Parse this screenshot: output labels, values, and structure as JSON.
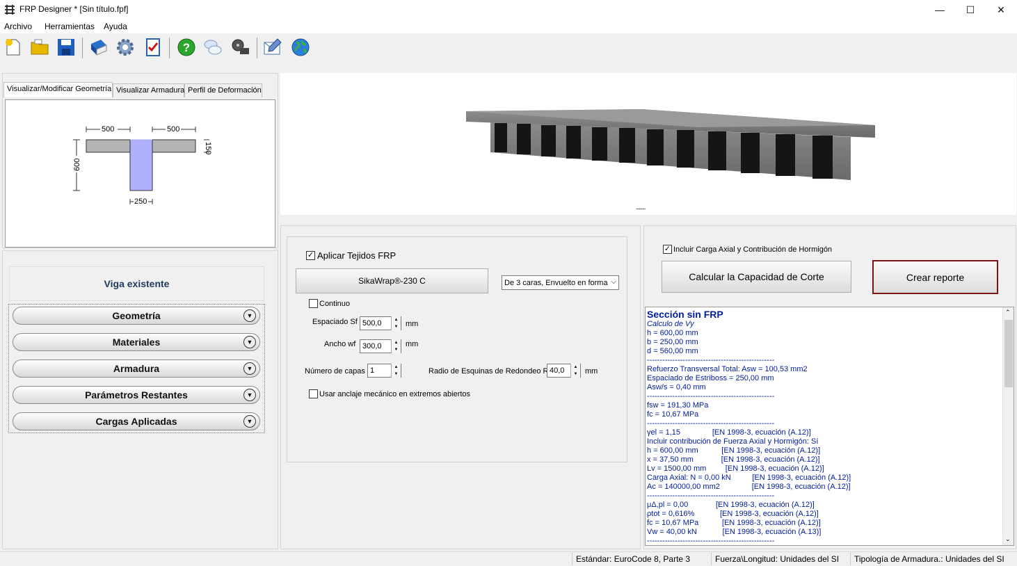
{
  "window": {
    "title": "FRP Designer * [Sin título.fpf]",
    "minimize": "—",
    "maximize": "☐",
    "close": "✕"
  },
  "menu": [
    "Archivo",
    "Herramientas",
    "Ayuda"
  ],
  "toolbar": {
    "icons": [
      "new-file-icon",
      "open-folder-icon",
      "save-icon",
      "book-icon",
      "gear-icon",
      "checklist-icon",
      "help-icon",
      "chat-icon",
      "film-icon",
      "mail-icon",
      "globe-icon"
    ]
  },
  "left": {
    "tabs": [
      "Visualizar/Modificar Geometría",
      "Visualizar Armadura",
      "Perfil de Deformación"
    ],
    "geometry": {
      "flange_left": "500",
      "flange_right": "500",
      "flange_thickness": "150",
      "height": "600",
      "web_width": "250"
    },
    "section_title": "Viga existente",
    "accordion": [
      "Geometría",
      "Materiales",
      "Armadura",
      "Parámetros Restantes",
      "Cargas Aplicadas"
    ]
  },
  "viewer": {
    "splitter": "........."
  },
  "frp": {
    "apply_label": "Aplicar Tejidos FRP",
    "apply_checked": "✓",
    "product_button": "SikaWrap®-230 C",
    "config_select": "De 3 caras, Envuelto en forma",
    "continuous_label": "Continuo",
    "spacing_label": "Espaciado Sf",
    "spacing_value": "500,0",
    "width_label": "Ancho wf",
    "width_value": "300,0",
    "unit_mm": "mm",
    "layers_label": "Número de capas",
    "layers_value": "1",
    "radius_label": "Radio de Esquinas de Redondeo R",
    "radius_value": "40,0",
    "anchor_label": "Usar anclaje mecánico en extremos abiertos"
  },
  "calc": {
    "axial_label": "Incluir Carga Axial y Contribución de Hormigón",
    "axial_checked": "✓",
    "calc_button": "Calcular la Capacidad de Corte",
    "report_button": "Crear reporte"
  },
  "report": [
    {
      "t": "Sección sin FRP",
      "s": "h"
    },
    {
      "t": "Calculo de Vy",
      "s": "i"
    },
    {
      "t": "h = 600,00 mm",
      "s": ""
    },
    {
      "t": "b = 250,00 mm",
      "s": ""
    },
    {
      "t": "d = 560,00 mm",
      "s": ""
    },
    {
      "t": "--------------------------------------------------",
      "s": ""
    },
    {
      "t": "Refuerzo Transversal Total: Asw = 100,53 mm2",
      "s": ""
    },
    {
      "t": "Espaciado de Estriboss = 250,00 mm",
      "s": ""
    },
    {
      "t": "Asw/s = 0,40 mm",
      "s": ""
    },
    {
      "t": "--------------------------------------------------",
      "s": ""
    },
    {
      "t": "fsw = 191,30 MPa",
      "s": ""
    },
    {
      "t": "fc = 10,67 MPa",
      "s": ""
    },
    {
      "t": "--------------------------------------------------",
      "s": ""
    },
    {
      "t": "γel = 1,15               [EN 1998-3, ecuación (A.12)]",
      "s": ""
    },
    {
      "t": "Incluir contribución de Fuerza Axial y Hormigón: Sí",
      "s": ""
    },
    {
      "t": "h = 600,00 mm           [EN 1998-3, ecuación (A.12)]",
      "s": ""
    },
    {
      "t": "x = 37,50 mm             [EN 1998-3, ecuación (A.12)]",
      "s": ""
    },
    {
      "t": "Lv = 1500,00 mm         [EN 1998-3, ecuación (A.12)]",
      "s": ""
    },
    {
      "t": "Carga Axial: N = 0,00 kN          [EN 1998-3, ecuación (A.12)]",
      "s": ""
    },
    {
      "t": "Ac = 140000,00 mm2               [EN 1998-3, ecuación (A.12)]",
      "s": ""
    },
    {
      "t": "--------------------------------------------------",
      "s": ""
    },
    {
      "t": "μΔ,pl = 0,00             [EN 1998-3, ecuación (A.12)]",
      "s": ""
    },
    {
      "t": "ρtot = 0,616%            [EN 1998-3, ecuación (A.12)]",
      "s": ""
    },
    {
      "t": "fc = 10,67 MPa           [EN 1998-3, ecuación (A.12)]",
      "s": ""
    },
    {
      "t": "Vw = 40,00 kN            [EN 1998-3, ecuación (A.13)]",
      "s": ""
    },
    {
      "t": "--------------------------------------------------",
      "s": ""
    }
  ],
  "status": {
    "standard": "Estándar: EuroCode 8, Parte 3",
    "units": "Fuerza\\Longitud: Unidades del SI",
    "rebar": "Tipología de Armadura.: Unidades del SI"
  }
}
